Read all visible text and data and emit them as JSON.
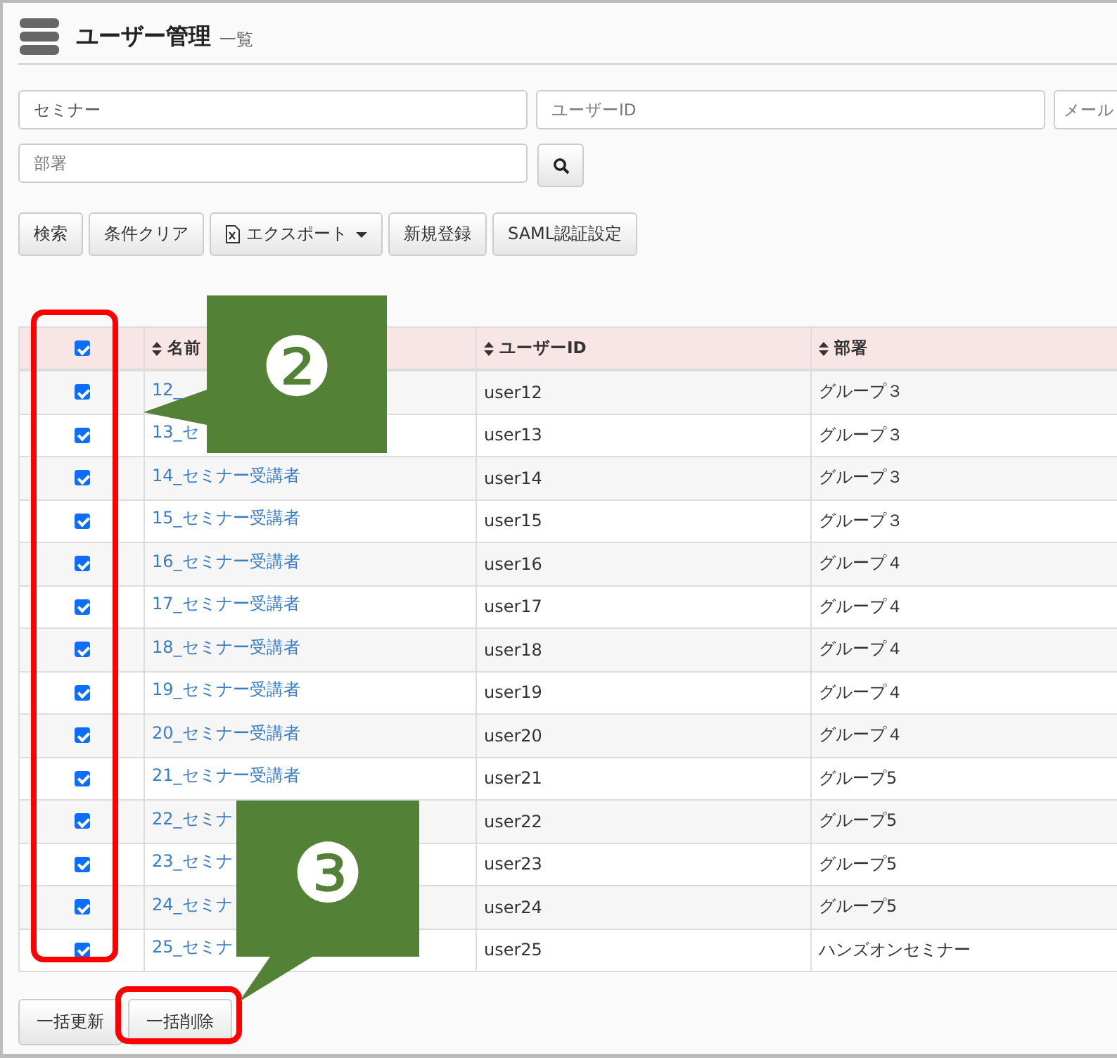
{
  "header": {
    "title": "ユーザー管理",
    "subtitle": "一覧"
  },
  "filters": [
    {
      "value": "セミナー"
    },
    {
      "placeholder": "ユーザーID"
    },
    {
      "placeholder": "メール"
    },
    {
      "placeholder": "部署"
    }
  ],
  "toolbar": [
    {
      "label": "検索",
      "kind": "plain"
    },
    {
      "label": "条件クリア",
      "kind": "plain"
    },
    {
      "label": "エクスポート",
      "kind": "export"
    },
    {
      "label": "新規登録",
      "kind": "plain"
    },
    {
      "label": "SAML認証設定",
      "kind": "plain"
    }
  ],
  "table": {
    "select_all": {
      "checked": true
    },
    "columns": [
      "名前",
      "ユーザーID",
      "部署"
    ],
    "rows": [
      {
        "checked": true,
        "name": "12_",
        "user_id": "user12",
        "department": "グループ３"
      },
      {
        "checked": true,
        "name": "13_セ",
        "user_id": "user13",
        "department": "グループ３"
      },
      {
        "checked": true,
        "name": "14_セミナー受講者",
        "user_id": "user14",
        "department": "グループ３"
      },
      {
        "checked": true,
        "name": "15_セミナー受講者",
        "user_id": "user15",
        "department": "グループ３"
      },
      {
        "checked": true,
        "name": "16_セミナー受講者",
        "user_id": "user16",
        "department": "グループ４"
      },
      {
        "checked": true,
        "name": "17_セミナー受講者",
        "user_id": "user17",
        "department": "グループ４"
      },
      {
        "checked": true,
        "name": "18_セミナー受講者",
        "user_id": "user18",
        "department": "グループ４"
      },
      {
        "checked": true,
        "name": "19_セミナー受講者",
        "user_id": "user19",
        "department": "グループ４"
      },
      {
        "checked": true,
        "name": "20_セミナー受講者",
        "user_id": "user20",
        "department": "グループ４"
      },
      {
        "checked": true,
        "name": "21_セミナー受講者",
        "user_id": "user21",
        "department": "グループ5"
      },
      {
        "checked": true,
        "name": "22_セミナ",
        "user_id": "user22",
        "department": "グループ5"
      },
      {
        "checked": true,
        "name": "23_セミナ",
        "user_id": "user23",
        "department": "グループ5"
      },
      {
        "checked": true,
        "name": "24_セミナ",
        "user_id": "user24",
        "department": "グループ5"
      },
      {
        "checked": true,
        "name": "25_セミナ",
        "user_id": "user25",
        "department": "ハンズオンセミナー"
      }
    ]
  },
  "bottom_buttons": [
    "一括更新",
    "一括削除"
  ],
  "annotations": [
    {
      "kind": "highlight"
    },
    {
      "kind": "callout",
      "label": "❷"
    },
    {
      "kind": "highlight"
    },
    {
      "kind": "callout",
      "label": "❸"
    }
  ]
}
